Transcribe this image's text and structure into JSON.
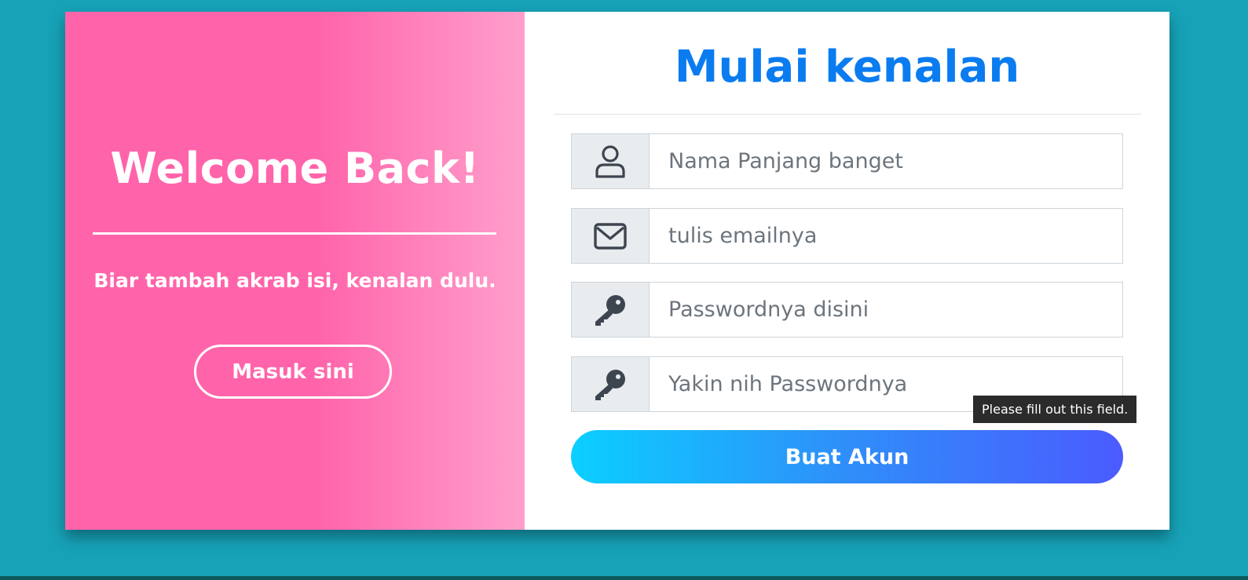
{
  "left_panel": {
    "title": "Welcome Back!",
    "subtitle": "Biar tambah akrab isi, kenalan dulu.",
    "login_button_label": "Masuk sini"
  },
  "form": {
    "title": "Mulai kenalan",
    "fields": [
      {
        "icon": "user-icon",
        "placeholder": "Nama Panjang banget",
        "value": ""
      },
      {
        "icon": "envelope-icon",
        "placeholder": "tulis emailnya",
        "value": ""
      },
      {
        "icon": "key-icon",
        "placeholder": "Passwordnya disini",
        "value": ""
      },
      {
        "icon": "key-icon",
        "placeholder": "Yakin nih Passwordnya",
        "value": ""
      }
    ],
    "submit_label": "Buat Akun",
    "validation_tooltip": "Please fill out this field."
  },
  "colors": {
    "page_background": "#17a2b8",
    "left_gradient_start": "#ff64aa",
    "left_gradient_end": "#ff9fcc",
    "title_blue": "#0a7cf0",
    "button_gradient_start": "#0bcfff",
    "button_gradient_end": "#4b5bff"
  }
}
